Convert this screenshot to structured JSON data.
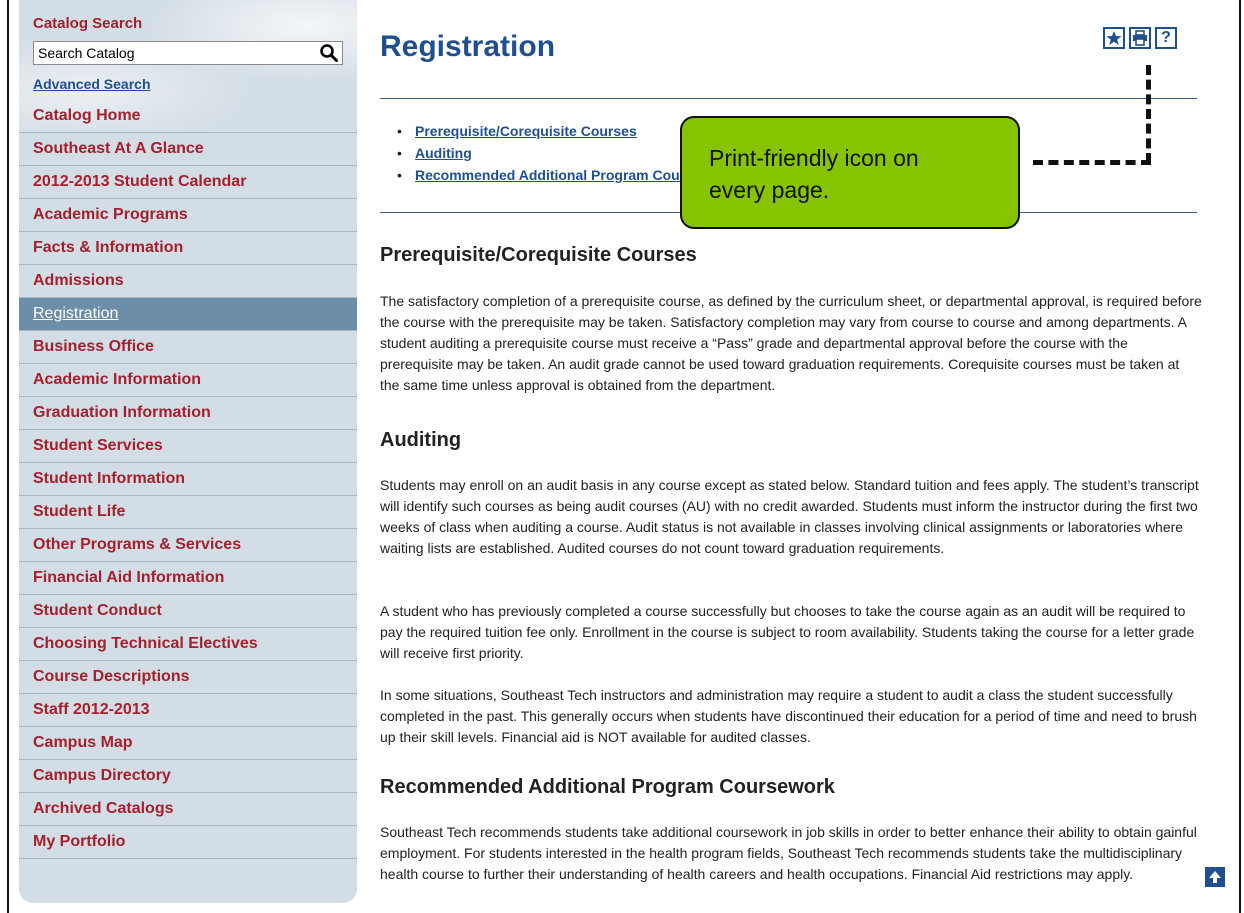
{
  "sidebar": {
    "catalog_search_title": "Catalog Search",
    "search_value": "Search Catalog",
    "advanced_search": "Advanced Search",
    "items": [
      {
        "label": "Catalog Home"
      },
      {
        "label": "Southeast At A Glance"
      },
      {
        "label": "2012-2013 Student Calendar"
      },
      {
        "label": "Academic Programs"
      },
      {
        "label": "Facts & Information"
      },
      {
        "label": "Admissions"
      },
      {
        "label": "Registration"
      },
      {
        "label": "Business Office"
      },
      {
        "label": "Academic Information"
      },
      {
        "label": "Graduation Information"
      },
      {
        "label": "Student Services"
      },
      {
        "label": "Student Information"
      },
      {
        "label": "Student Life"
      },
      {
        "label": "Other Programs & Services"
      },
      {
        "label": "Financial Aid Information"
      },
      {
        "label": "Student Conduct"
      },
      {
        "label": "Choosing Technical Electives"
      },
      {
        "label": "Course Descriptions"
      },
      {
        "label": "Staff 2012-2013"
      },
      {
        "label": "Campus Map"
      },
      {
        "label": "Campus Directory"
      },
      {
        "label": "Archived Catalogs"
      },
      {
        "label": "My Portfolio"
      }
    ],
    "active_item": "Registration"
  },
  "main": {
    "title": "Registration",
    "toolbar": {
      "icons": [
        "star-icon",
        "print-icon",
        "help-icon"
      ],
      "help_glyph": "?"
    },
    "toc": [
      {
        "label": "Prerequisite/Corequisite Courses"
      },
      {
        "label": "Auditing"
      },
      {
        "label": "Recommended Additional Program Coursework"
      }
    ],
    "callout": {
      "line1": "Print-friendly icon on",
      "line2": "every page."
    },
    "sections": [
      {
        "heading": "Prerequisite/Corequisite Courses",
        "paragraphs": [
          "The satisfactory completion of a prerequisite course, as defined by the curriculum sheet, or departmental approval, is required before the course with the prerequisite may be taken. Satisfactory completion may vary from course to course and among departments. A student auditing a prerequisite course must receive a “Pass” grade and departmental approval before the course with the prerequisite may be taken. An audit grade cannot be used toward graduation requirements. Corequisite courses must be taken at the same time unless approval is obtained from the department."
        ]
      },
      {
        "heading": "Auditing",
        "paragraphs": [
          "Students may enroll on an audit basis in any course except as stated below. Standard tuition and fees apply. The student’s transcript will identify such courses as being audit courses (AU) with no credit awarded. Students must inform the instructor during the first two weeks of class when auditing a course. Audit status is not available in classes involving clinical assignments or laboratories where waiting lists are established. Audited courses do not count toward graduation requirements.",
          "A student who has previously completed a course successfully but chooses to take the course again as an audit will be required to pay the required tuition fee only. Enrollment in the course is subject to room availability. Students taking the course for a letter grade will receive first priority.",
          "In some situations, Southeast Tech instructors and administration may require a student to audit a class the student successfully completed in the past. This generally occurs when students have discontinued their education for a period of time and need to brush up their skill levels. Financial aid is NOT available for audited classes."
        ]
      },
      {
        "heading": "Recommended Additional Program Coursework",
        "paragraphs": [
          "Southeast Tech recommends students take additional coursework in job skills in order to better enhance their ability to obtain gainful employment. For students interested in the health program fields, Southeast Tech recommends students take the multidisciplinary health course to further their understanding of health careers and health occupations. Financial Aid restrictions may apply."
        ]
      }
    ]
  },
  "colors": {
    "nav_text": "#a51f2d",
    "link": "#1f4f8f",
    "sidebar_bg": "#d3dde5",
    "active_bg": "#6d8ea8",
    "callout_bg": "#86c300"
  }
}
